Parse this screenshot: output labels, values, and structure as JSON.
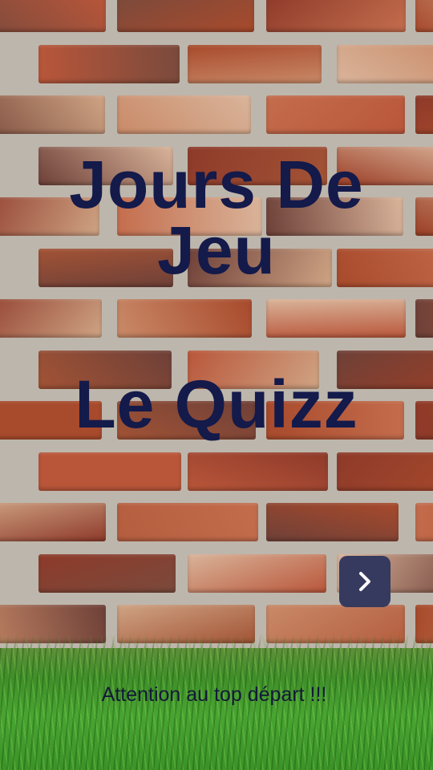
{
  "title": {
    "line1": "Jours De",
    "line2": "Jeu",
    "line3": "Le Quizz"
  },
  "next_button": {
    "icon": "chevron-right-icon"
  },
  "footer": {
    "text": "Attention au top départ !!!"
  },
  "colors": {
    "title": "#141a4a",
    "button": "#363a5e",
    "grass": "#48a532"
  }
}
